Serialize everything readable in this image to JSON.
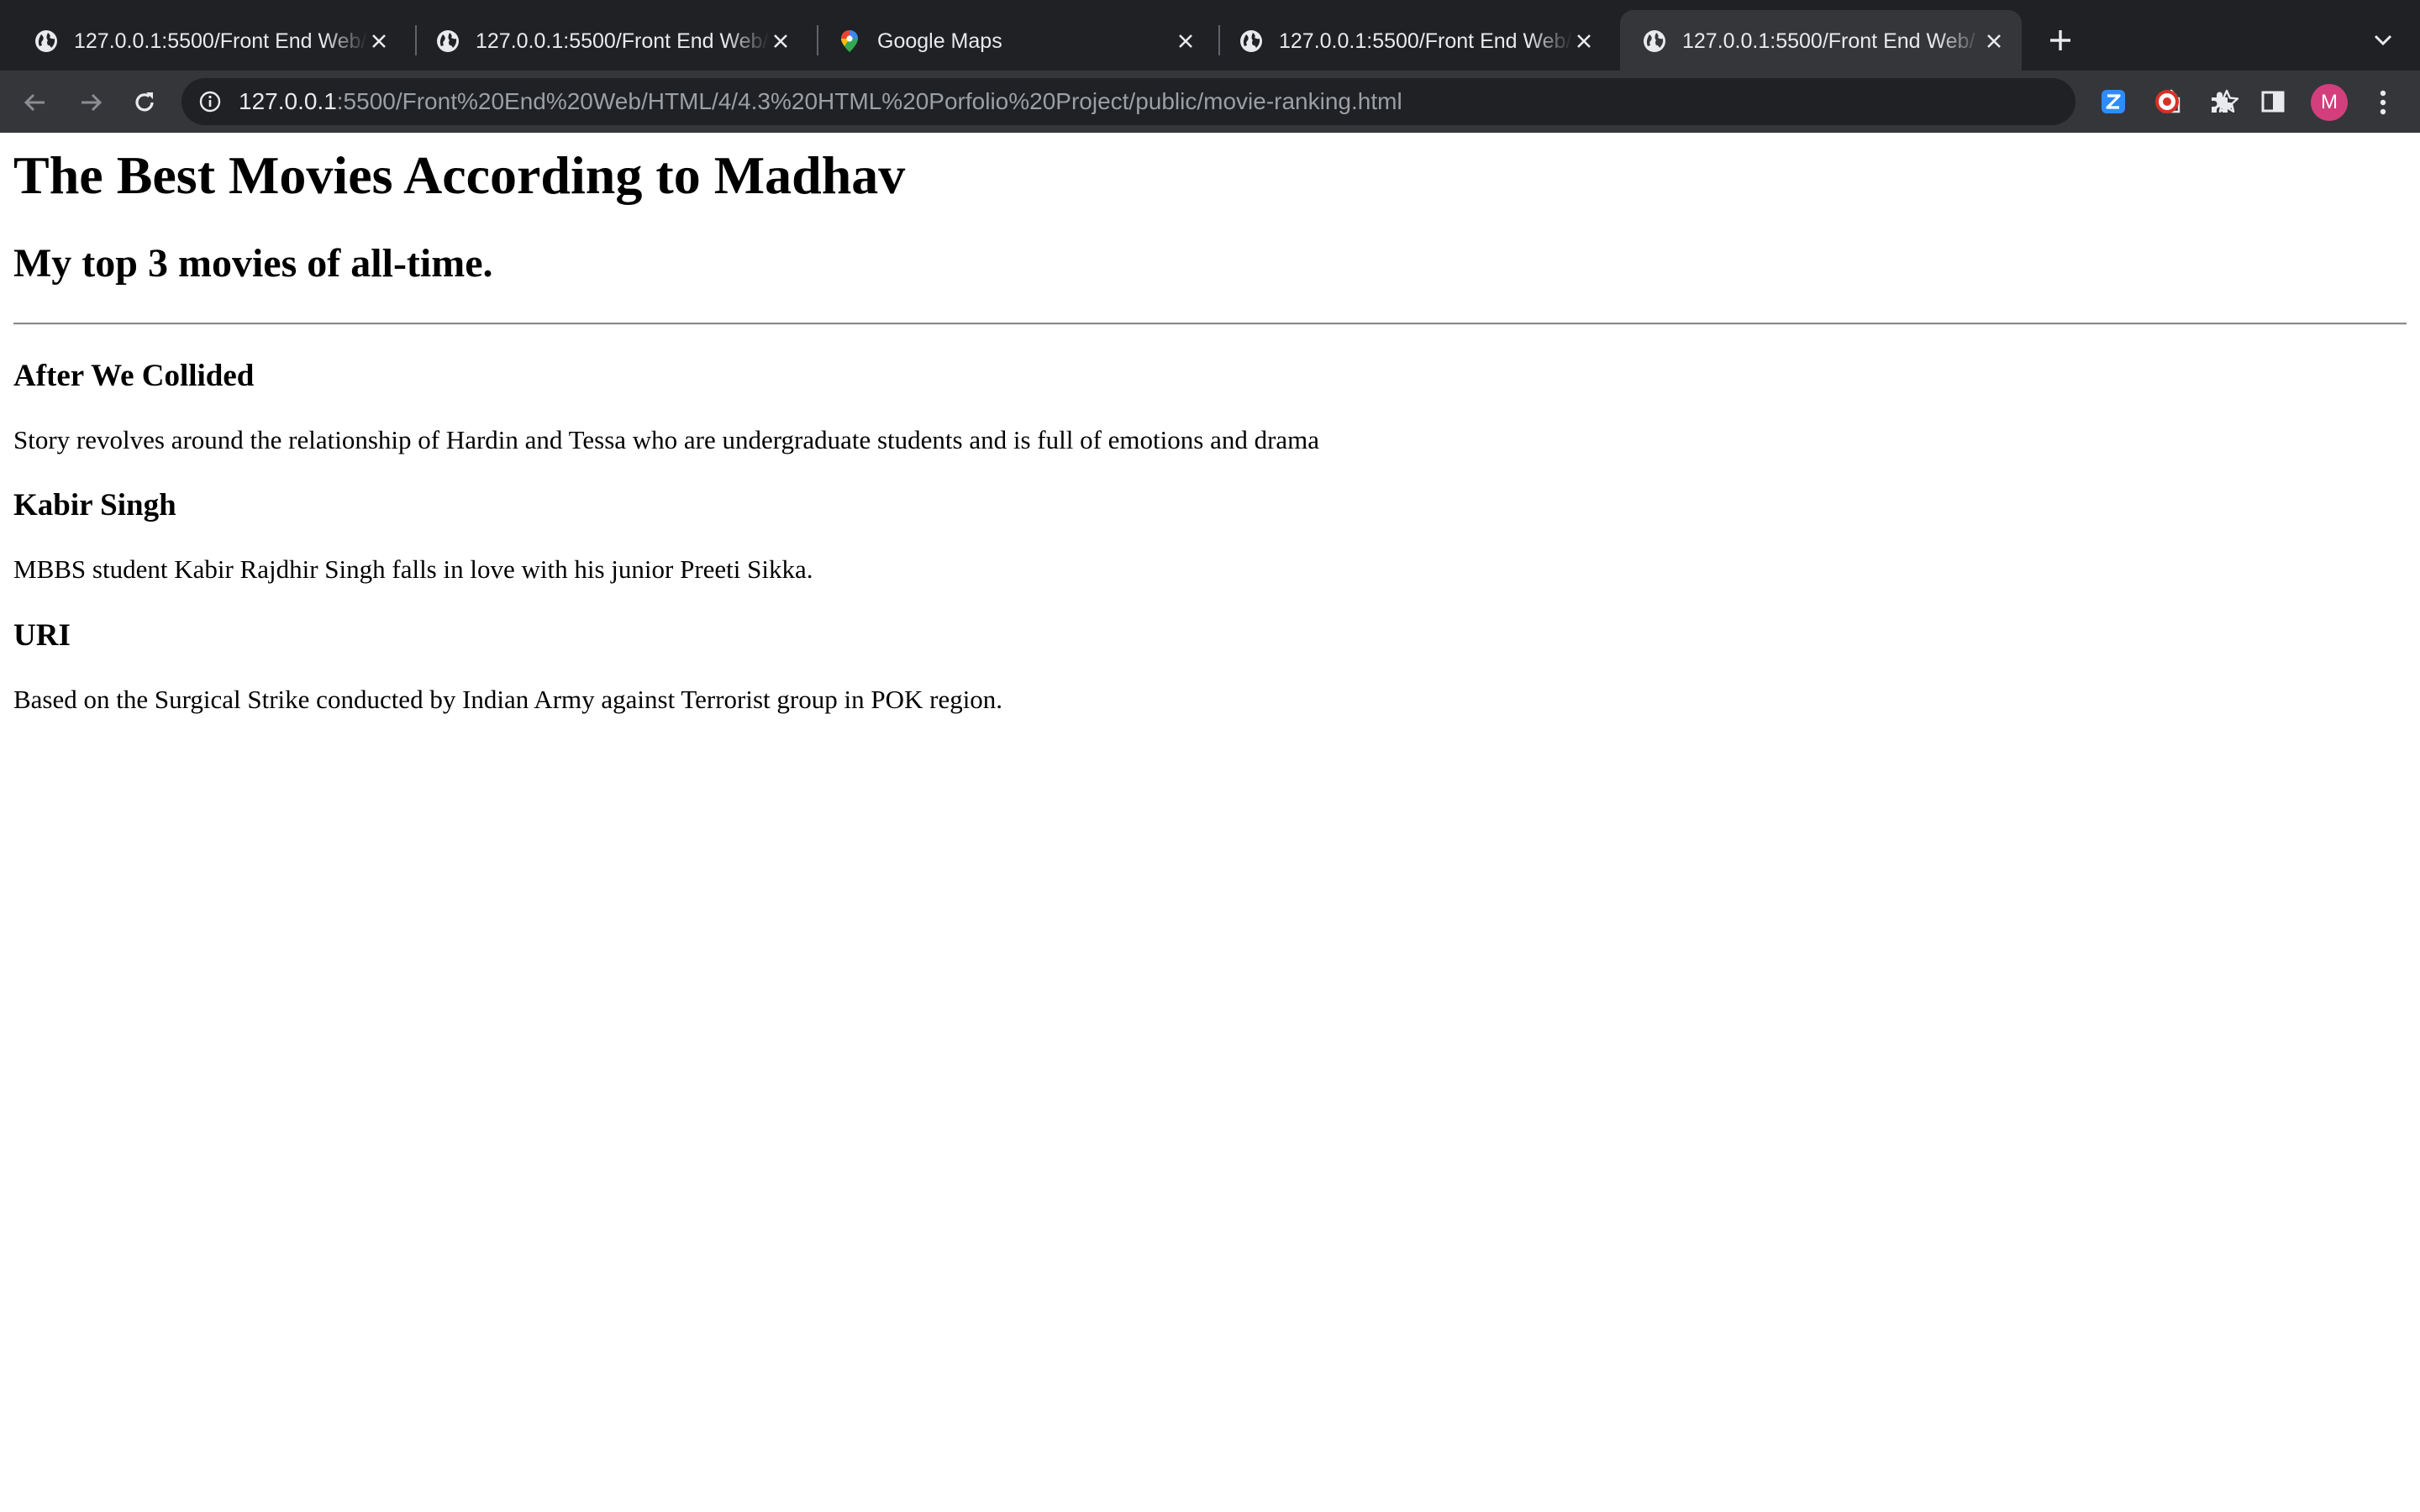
{
  "browser": {
    "tabs": [
      {
        "title": "127.0.0.1:5500/Front End Web/",
        "icon": "globe-icon",
        "active": false
      },
      {
        "title": "127.0.0.1:5500/Front End Web/",
        "icon": "globe-icon",
        "active": false
      },
      {
        "title": "Google Maps",
        "icon": "google-maps-icon",
        "active": false
      },
      {
        "title": "127.0.0.1:5500/Front End Web/",
        "icon": "globe-icon",
        "active": false
      },
      {
        "title": "127.0.0.1:5500/Front End Web/",
        "icon": "globe-icon",
        "active": true
      }
    ],
    "address_bar": {
      "host": "127.0.0.1",
      "path": ":5500/Front%20End%20Web/HTML/4/4.3%20HTML%20Porfolio%20Project/public/movie-ranking.html"
    },
    "extensions": [
      "zoom-extension-icon",
      "record-extension-icon",
      "puzzle-icon",
      "side-panel-icon"
    ],
    "profile_initial": "M",
    "colors": {
      "tabstrip": "#202124",
      "toolbar": "#35363a",
      "omnibox": "#202124",
      "avatar": "#d23f7c",
      "zoom_blue": "#2d8cff",
      "record_red": "#d93025"
    }
  },
  "page": {
    "title": "The Best Movies According to Madhav",
    "subtitle": "My top 3 movies of all-time.",
    "movies": [
      {
        "title": "After We Collided",
        "description": "Story revolves around the relationship of Hardin and Tessa who are undergraduate students and is full of emotions and drama"
      },
      {
        "title": "Kabir Singh",
        "description": "MBBS student Kabir Rajdhir Singh falls in love with his junior Preeti Sikka."
      },
      {
        "title": "URI",
        "description": "Based on the Surgical Strike conducted by Indian Army against Terrorist group in POK region."
      }
    ]
  }
}
